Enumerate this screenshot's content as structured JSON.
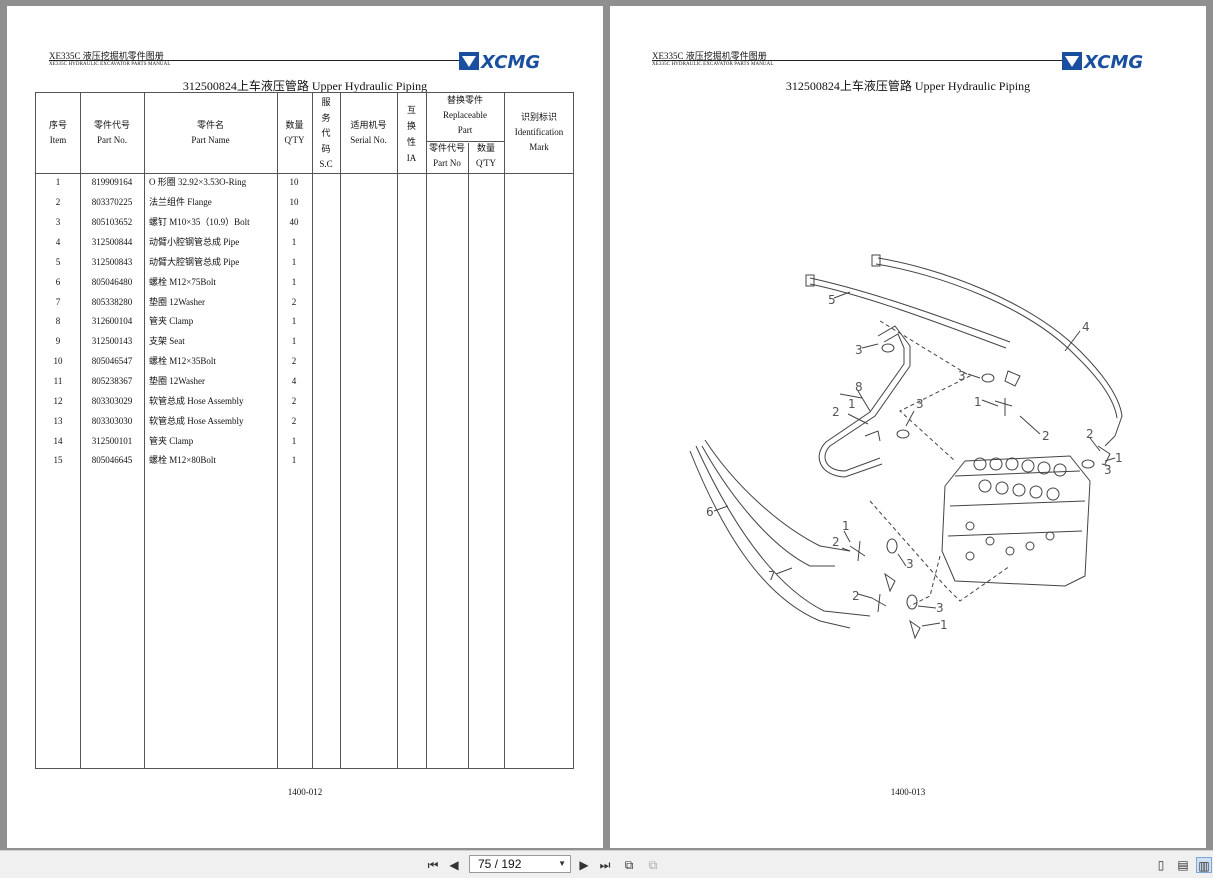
{
  "left_page": {
    "header_cn": "XE335C 液压挖掘机零件图册",
    "header_en": "XE335C HYDRAULIC EXCAVATOR PARTS MANUAL",
    "logo_text": "XCMG",
    "title": "312500824上车液压管路  Upper Hydraulic Piping",
    "columns": {
      "item_cn": "序号",
      "item_en": "Item",
      "part_cn": "零件代号",
      "part_en": "Part No.",
      "name_cn": "零件名",
      "name_en": "Part Name",
      "qty_cn": "数量",
      "qty_en": "Q'TY",
      "sc_1": "服",
      "sc_2": "务",
      "sc_3": "代",
      "sc_4": "码",
      "sc_en": "S.C",
      "serial_cn": "适用机号",
      "serial_en": "Serial No.",
      "ia_1": "互",
      "ia_2": "换",
      "ia_3": "性",
      "ia_en": "IA",
      "repl_cn": "替换零件",
      "repl_en1": "Replaceable",
      "repl_en2": "Part",
      "repl_part_cn": "零件代号",
      "repl_part_en": "Part No",
      "repl_qty_cn": "数量",
      "repl_qty_en": "Q'TY",
      "mark_cn": "识别标识",
      "mark_en1": "Identification",
      "mark_en2": "Mark"
    },
    "rows": [
      {
        "item": "1",
        "part": "819909164",
        "name": "O 形圈 32.92×3.53O-Ring",
        "qty": "10"
      },
      {
        "item": "2",
        "part": "803370225",
        "name": "法兰组件 Flange",
        "qty": "10"
      },
      {
        "item": "3",
        "part": "805103652",
        "name": "螺钉 M10×35（10.9）Bolt",
        "qty": "40"
      },
      {
        "item": "4",
        "part": "312500844",
        "name": "动臂小腔钢管总成 Pipe",
        "qty": "1"
      },
      {
        "item": "5",
        "part": "312500843",
        "name": "动臂大腔钢管总成 Pipe",
        "qty": "1"
      },
      {
        "item": "6",
        "part": "805046480",
        "name": "螺栓 M12×75Bolt",
        "qty": "1"
      },
      {
        "item": "7",
        "part": "805338280",
        "name": "垫圈 12Washer",
        "qty": "2"
      },
      {
        "item": "8",
        "part": "312600104",
        "name": "管夹 Clamp",
        "qty": "1"
      },
      {
        "item": "9",
        "part": "312500143",
        "name": "支架 Seat",
        "qty": "1"
      },
      {
        "item": "10",
        "part": "805046547",
        "name": "螺栓 M12×35Bolt",
        "qty": "2"
      },
      {
        "item": "11",
        "part": "805238367",
        "name": "垫圈 12Washer",
        "qty": "4"
      },
      {
        "item": "12",
        "part": "803303029",
        "name": "软管总成 Hose Assembly",
        "qty": "2"
      },
      {
        "item": "13",
        "part": "803303030",
        "name": "软管总成 Hose Assembly",
        "qty": "2"
      },
      {
        "item": "14",
        "part": "312500101",
        "name": "管夹 Clamp",
        "qty": "1"
      },
      {
        "item": "15",
        "part": "805046645",
        "name": "螺栓 M12×80Bolt",
        "qty": "1"
      }
    ],
    "footer": "1400-012"
  },
  "right_page": {
    "header_cn": "XE335C 液压挖掘机零件图册",
    "header_en": "XE335C HYDRAULIC EXCAVATOR PARTS MANUAL",
    "logo_text": "XCMG",
    "title": "312500824上车液压管路  Upper Hydraulic Piping",
    "callouts": [
      "1",
      "2",
      "3",
      "4",
      "5",
      "6",
      "7",
      "8"
    ],
    "footer": "1400-013"
  },
  "toolbar": {
    "page_indicator": "75 / 192",
    "icons": [
      "first-page-icon",
      "previous-page-icon",
      "next-page-icon",
      "last-page-icon",
      "fit-page-icon",
      "fit-width-icon",
      "single-page-view-icon",
      "continuous-view-icon",
      "two-page-view-icon"
    ]
  }
}
